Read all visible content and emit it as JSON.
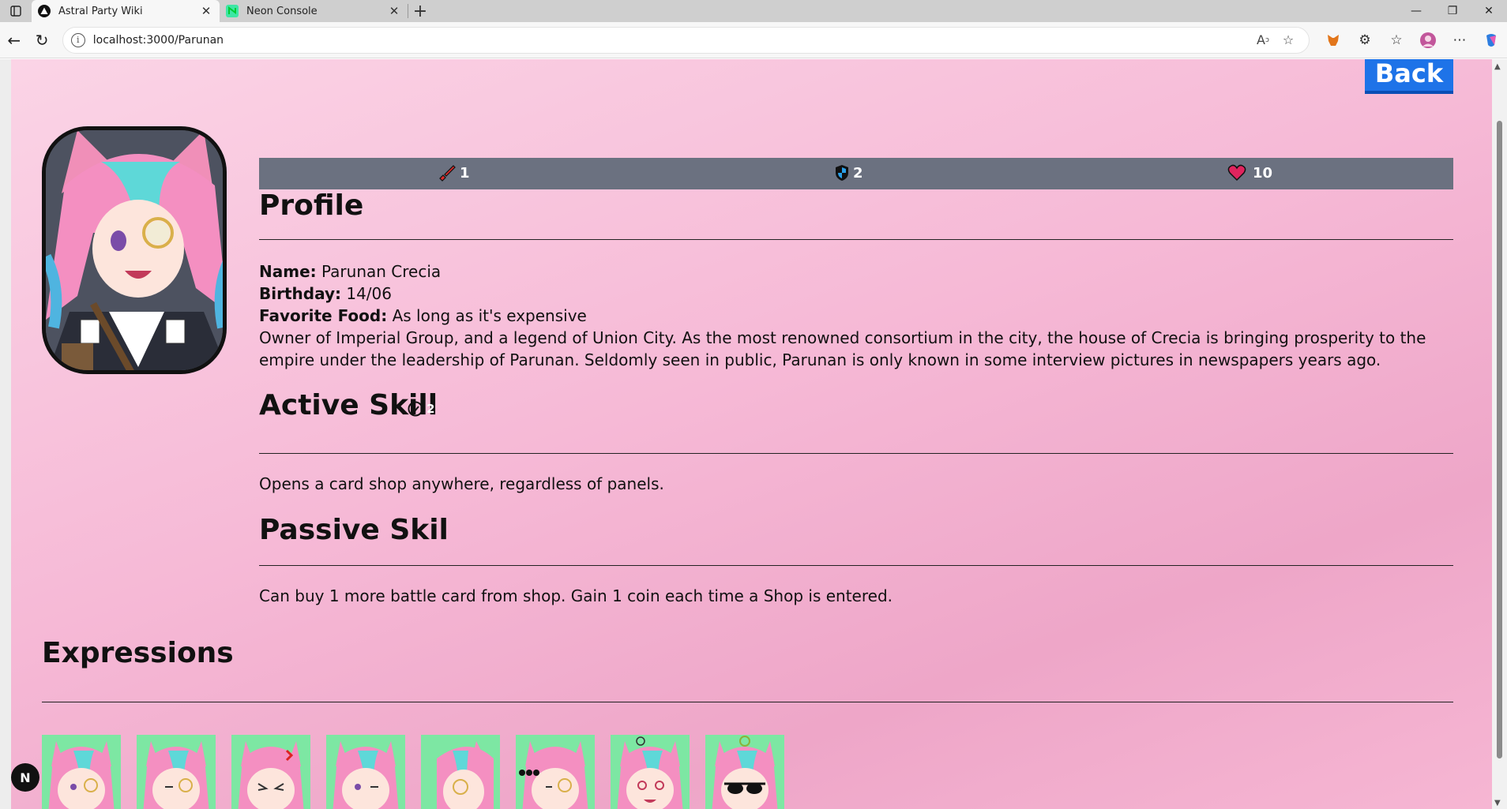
{
  "browser": {
    "tabs": [
      {
        "title": "Astral Party Wiki",
        "active": true
      },
      {
        "title": "Neon Console",
        "active": false
      }
    ],
    "url": "localhost:3000/Parunan"
  },
  "page": {
    "back_label": "Back",
    "stats": {
      "attack": "1",
      "defense": "2",
      "health": "10"
    },
    "profile": {
      "heading": "Profile",
      "name_label": "Name:",
      "name_value": " Parunan Crecia",
      "birthday_label": "Birthday:",
      "birthday_value": " 14/06",
      "food_label": "Favorite Food:",
      "food_value": " As long as it's expensive",
      "description": "Owner of Imperial Group, and a legend of Union City. As the most renowned consortium in the city, the house of Crecia is bringing prosperity to the empire under the leadership of Parunan. Seldomly seen in public, Parunan is only known in some interview pictures in newspapers years ago."
    },
    "active_skill": {
      "heading": "Active Skill",
      "cooldown": "2",
      "text": "Opens a card shop anywhere, regardless of panels."
    },
    "passive_skill": {
      "heading": "Passive Skil",
      "text": "Can buy 1 more battle card from shop. Gain 1 coin each time a Shop is entered."
    },
    "expressions": {
      "heading": "Expressions",
      "count": 8
    },
    "dev_badge": "N"
  }
}
